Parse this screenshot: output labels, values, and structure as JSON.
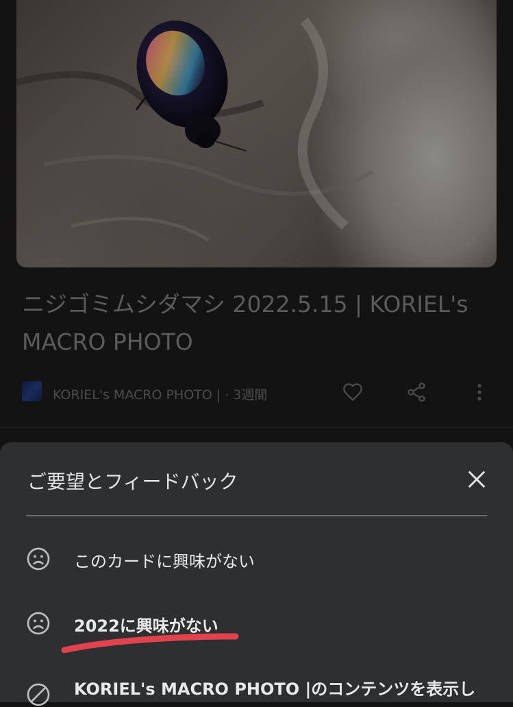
{
  "card": {
    "title": "ニジゴミムシダマシ 2022.5.15 | KORIEL's MACRO PHOTO",
    "source": "KORIEL's MACRO PHOTO |",
    "age": " · 3週間"
  },
  "sheet": {
    "title": "ご要望とフィードバック",
    "options": [
      {
        "label": "このカードに興味がない",
        "icon": "sad-face-icon"
      },
      {
        "label": "2022に興味がない",
        "icon": "sad-face-icon"
      },
      {
        "label": "KORIEL's MACRO PHOTO |のコンテンツを表示し",
        "icon": "block-icon"
      }
    ]
  },
  "colors": {
    "background": "#131313",
    "sheet": "#2e2f31",
    "annotation_underline": "#e0434e"
  }
}
